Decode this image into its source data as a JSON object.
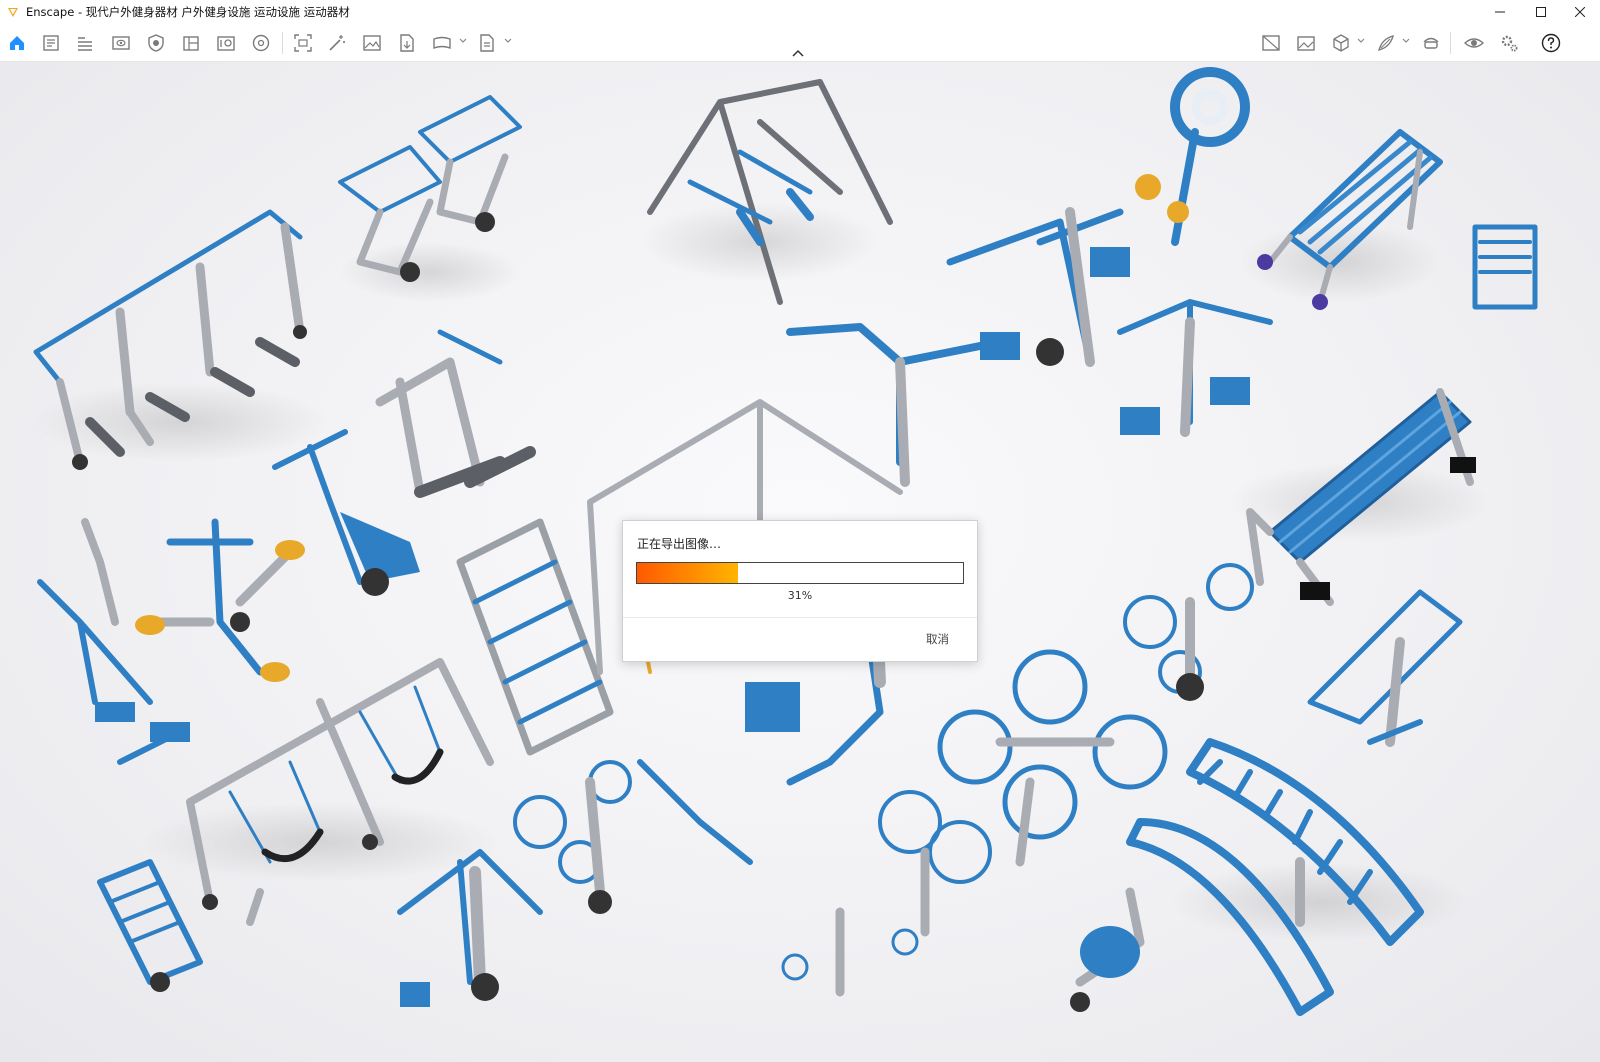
{
  "window": {
    "title": "Enscape - 现代户外健身器材 户外健身设施 运动设施 运动器材",
    "controls": [
      "minimize-icon",
      "maximize-icon",
      "close-icon"
    ]
  },
  "toolbar": {
    "left_icons": [
      "home-icon",
      "project-notes-icon",
      "bim-icon",
      "views-icon",
      "visual-settings-icon",
      "material-editor-icon",
      "asset-library-icon",
      "orbit-icon",
      "batch-render-icon",
      "magic-icon",
      "screenshot-icon",
      "export-icon",
      "panorama-icon",
      "export-dropdown-icon"
    ],
    "right_icons": [
      "compare-icon",
      "gallery-icon",
      "site-context-icon",
      "sketch-mode-icon",
      "vr-icon",
      "eye-icon",
      "settings-icon",
      "help-icon"
    ],
    "colors": {
      "home": "#1e90ff",
      "icon": "#7a7a7a"
    }
  },
  "dialog": {
    "title": "正在导出图像…",
    "progress": 0.31,
    "progress_label": "31%",
    "cancel_label": "取消",
    "colors": {
      "fill_start": "#ff5a00",
      "fill_end": "#ffb400"
    }
  },
  "scene": {
    "colors": {
      "equipment": "#2f7fc4",
      "post": "#a9adb3",
      "seat": "#e8a92b"
    }
  }
}
